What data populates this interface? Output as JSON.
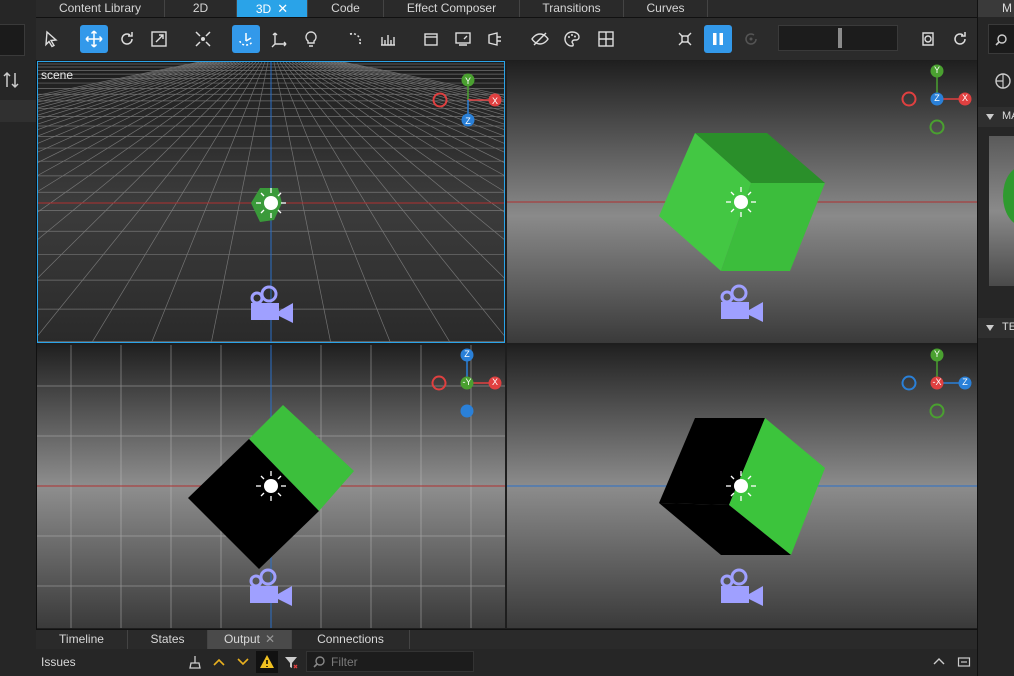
{
  "tabs": [
    {
      "label": "Content Library"
    },
    {
      "label": "2D"
    },
    {
      "label": "3D",
      "active": true
    },
    {
      "label": "Code"
    },
    {
      "label": "Effect Composer"
    },
    {
      "label": "Transitions"
    },
    {
      "label": "Curves"
    }
  ],
  "toolbar_icons": [
    "select-pointer-icon",
    "move-icon",
    "rotate-icon",
    "scale-icon",
    "fit-icon",
    "camera-orbit-icon",
    "local-orientation-icon",
    "light-icon",
    "snap-icon",
    "ruler-icon",
    "box-icon",
    "screen-icon",
    "camera-view-icon",
    "hide-icon",
    "color-palette-icon",
    "grid-icon",
    "select-all-icon",
    "pause-icon",
    "particles-icon",
    "record-icon",
    "reset-icon"
  ],
  "viewports": {
    "top_left": {
      "label": "scene",
      "selected": true
    },
    "gizmo_top_left": {
      "axes": [
        "Y",
        "X",
        "Z"
      ]
    },
    "gizmo_top_right": {
      "axes": [
        "Y",
        "Z",
        "X"
      ]
    },
    "gizmo_bottom_left": {
      "axes": [
        "Z",
        "-Y",
        "X"
      ]
    },
    "gizmo_bottom_right": {
      "axes": [
        "Y",
        "-X",
        "Z"
      ]
    }
  },
  "bottom_tabs": [
    {
      "label": "Timeline"
    },
    {
      "label": "States"
    },
    {
      "label": "Output",
      "active": true
    },
    {
      "label": "Connections"
    }
  ],
  "issues": {
    "label": "Issues",
    "filter_placeholder": "Filter"
  },
  "right_panel": {
    "tab": "M",
    "section1": "MA",
    "section2": "TE"
  },
  "colors": {
    "accent": "#2aa3e8",
    "cube_green": "#3cc43c",
    "axis_x": "#e04040",
    "axis_y": "#4aa030",
    "axis_z": "#2a80d8"
  }
}
